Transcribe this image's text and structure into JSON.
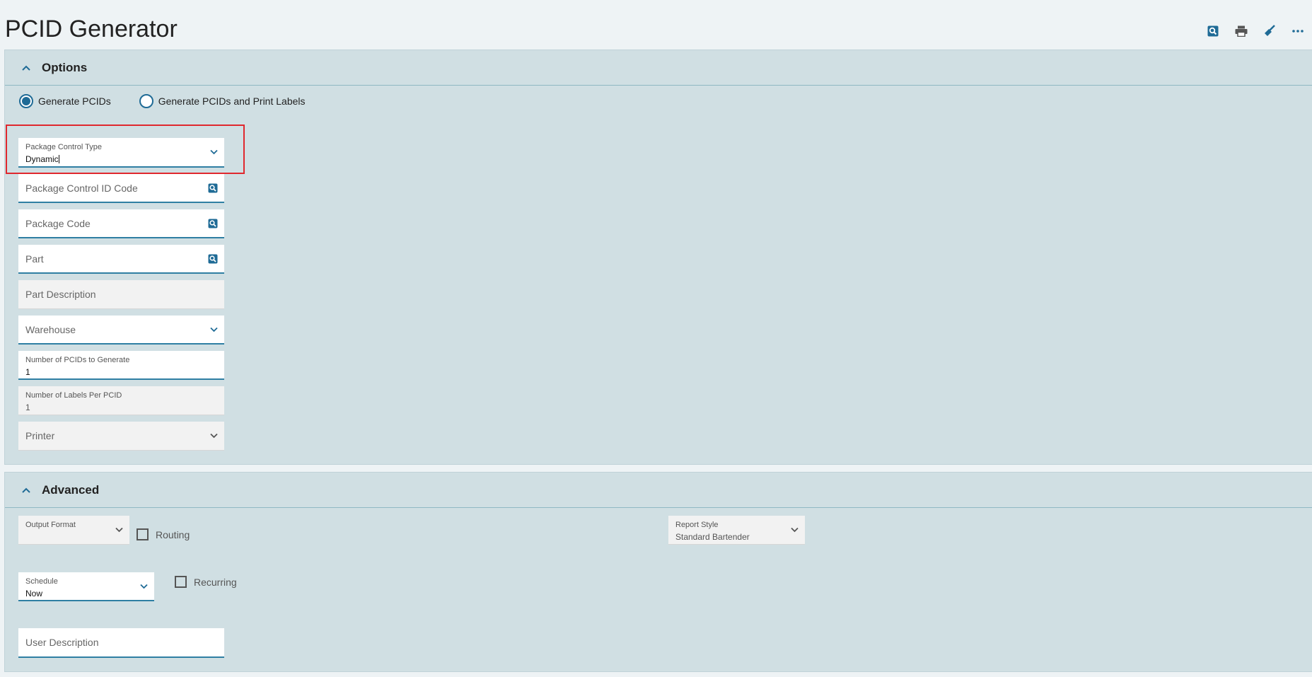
{
  "page": {
    "title": "PCID Generator"
  },
  "toolbar": {
    "items": [
      {
        "name": "search-icon"
      },
      {
        "name": "print-icon"
      },
      {
        "name": "clear-icon"
      },
      {
        "name": "more-icon"
      }
    ]
  },
  "options": {
    "title": "Options",
    "radios": [
      {
        "label": "Generate PCIDs",
        "checked": true
      },
      {
        "label": "Generate PCIDs and Print Labels",
        "checked": false
      }
    ],
    "package_control_type": {
      "label": "Package Control Type",
      "value": "Dynamic"
    },
    "package_control_id_code": {
      "placeholder": "Package Control ID Code"
    },
    "package_code": {
      "placeholder": "Package Code"
    },
    "part": {
      "placeholder": "Part"
    },
    "part_description": {
      "placeholder": "Part Description"
    },
    "warehouse": {
      "placeholder": "Warehouse"
    },
    "num_pcids": {
      "label": "Number of PCIDs to Generate",
      "value": "1"
    },
    "num_labels": {
      "label": "Number of Labels Per PCID",
      "value": "1"
    },
    "printer": {
      "placeholder": "Printer"
    }
  },
  "advanced": {
    "title": "Advanced",
    "output_format": {
      "label": "Output Format",
      "value": ""
    },
    "routing": {
      "label": "Routing"
    },
    "report_style": {
      "label": "Report Style",
      "value": "Standard Bartender"
    },
    "schedule": {
      "label": "Schedule",
      "value": "Now"
    },
    "recurring": {
      "label": "Recurring"
    },
    "user_description": {
      "placeholder": "User Description"
    }
  },
  "colors": {
    "accent": "#1f6b96",
    "highlight": "#e0282e",
    "section_bg": "#d0dfe3",
    "page_bg": "#eef3f5"
  }
}
